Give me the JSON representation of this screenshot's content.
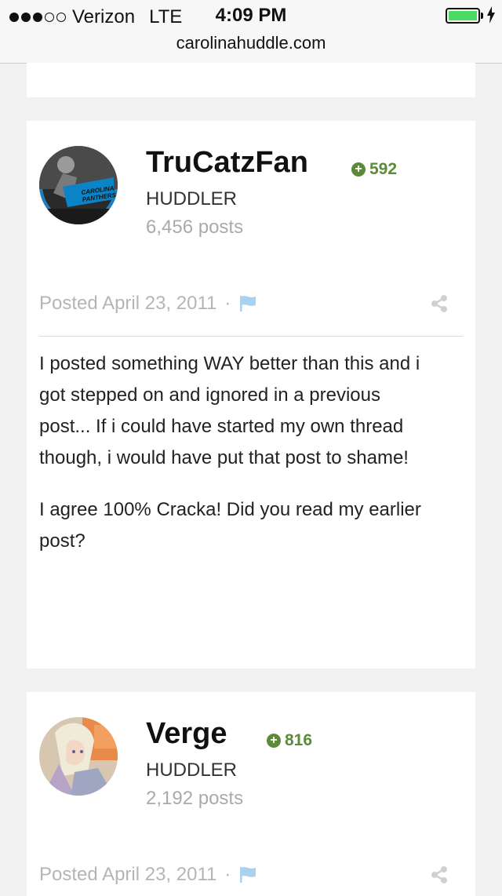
{
  "status_bar": {
    "carrier": "Verizon",
    "network": "LTE",
    "time": "4:09 PM",
    "url": "carolinahuddle.com",
    "signal_bars_filled": 3,
    "signal_bars_total": 5,
    "battery_level": 1.0
  },
  "posts": [
    {
      "author": "TruCatzFan",
      "reputation": "592",
      "rank": "HUDDLER",
      "post_count": "6,456 posts",
      "posted": "Posted April 23, 2011",
      "separator": "·",
      "avatar_text": "CAROLINA PANTHERS",
      "body": [
        "I posted something WAY better than this and i got stepped on and ignored in a previous post... If i could have started my own thread though, i would have put that post to shame!",
        "I agree 100% Cracka! Did you read my earlier post?"
      ]
    },
    {
      "author": "Verge",
      "reputation": "816",
      "rank": "HUDDLER",
      "post_count": "2,192 posts",
      "posted": "Posted April 23, 2011",
      "separator": "·"
    }
  ],
  "colors": {
    "reputation_green": "#5b8a3a",
    "flag_blue": "#a9d1f0",
    "muted_text": "#b5b5b5"
  },
  "icons": [
    "plus-circle-icon",
    "flag-icon",
    "share-icon",
    "battery-icon",
    "charging-bolt-icon"
  ]
}
